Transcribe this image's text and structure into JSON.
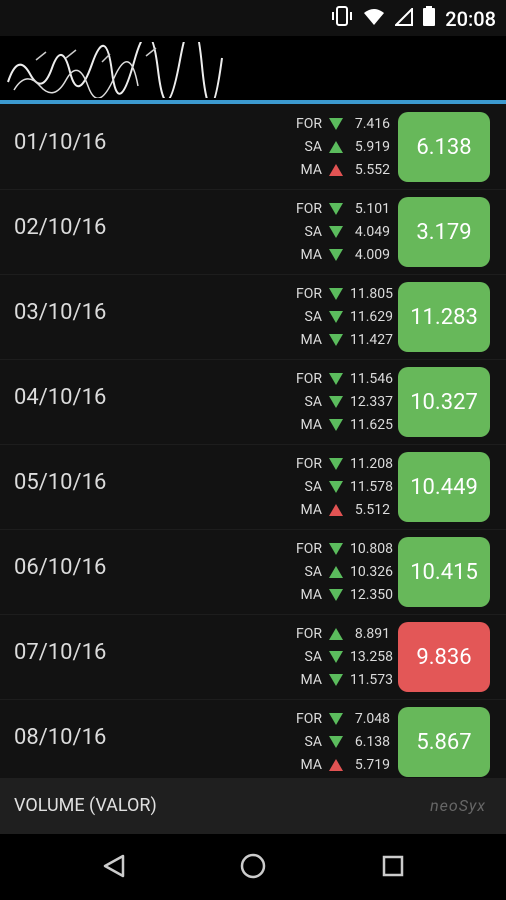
{
  "status_bar": {
    "time": "20:08"
  },
  "footer": {
    "label": "VOLUME (VALOR)",
    "brand": "neoSyx"
  },
  "rows": [
    {
      "date": "01/10/16",
      "value": "6.138",
      "value_color": "green",
      "metrics": [
        {
          "label": "FOR",
          "trend": "down",
          "trend_color": "green",
          "value": "7.416"
        },
        {
          "label": "SA",
          "trend": "up",
          "trend_color": "green",
          "value": "5.919"
        },
        {
          "label": "MA",
          "trend": "up",
          "trend_color": "red",
          "value": "5.552"
        }
      ]
    },
    {
      "date": "02/10/16",
      "value": "3.179",
      "value_color": "green",
      "metrics": [
        {
          "label": "FOR",
          "trend": "down",
          "trend_color": "green",
          "value": "5.101"
        },
        {
          "label": "SA",
          "trend": "down",
          "trend_color": "green",
          "value": "4.049"
        },
        {
          "label": "MA",
          "trend": "down",
          "trend_color": "green",
          "value": "4.009"
        }
      ]
    },
    {
      "date": "03/10/16",
      "value": "11.283",
      "value_color": "green",
      "metrics": [
        {
          "label": "FOR",
          "trend": "down",
          "trend_color": "green",
          "value": "11.805"
        },
        {
          "label": "SA",
          "trend": "down",
          "trend_color": "green",
          "value": "11.629"
        },
        {
          "label": "MA",
          "trend": "down",
          "trend_color": "green",
          "value": "11.427"
        }
      ]
    },
    {
      "date": "04/10/16",
      "value": "10.327",
      "value_color": "green",
      "metrics": [
        {
          "label": "FOR",
          "trend": "down",
          "trend_color": "green",
          "value": "11.546"
        },
        {
          "label": "SA",
          "trend": "down",
          "trend_color": "green",
          "value": "12.337"
        },
        {
          "label": "MA",
          "trend": "down",
          "trend_color": "green",
          "value": "11.625"
        }
      ]
    },
    {
      "date": "05/10/16",
      "value": "10.449",
      "value_color": "green",
      "metrics": [
        {
          "label": "FOR",
          "trend": "down",
          "trend_color": "green",
          "value": "11.208"
        },
        {
          "label": "SA",
          "trend": "down",
          "trend_color": "green",
          "value": "11.578"
        },
        {
          "label": "MA",
          "trend": "up",
          "trend_color": "red",
          "value": "5.512"
        }
      ]
    },
    {
      "date": "06/10/16",
      "value": "10.415",
      "value_color": "green",
      "metrics": [
        {
          "label": "FOR",
          "trend": "down",
          "trend_color": "green",
          "value": "10.808"
        },
        {
          "label": "SA",
          "trend": "up",
          "trend_color": "green",
          "value": "10.326"
        },
        {
          "label": "MA",
          "trend": "down",
          "trend_color": "green",
          "value": "12.350"
        }
      ]
    },
    {
      "date": "07/10/16",
      "value": "9.836",
      "value_color": "red",
      "metrics": [
        {
          "label": "FOR",
          "trend": "up",
          "trend_color": "green",
          "value": "8.891"
        },
        {
          "label": "SA",
          "trend": "down",
          "trend_color": "green",
          "value": "13.258"
        },
        {
          "label": "MA",
          "trend": "down",
          "trend_color": "green",
          "value": "11.573"
        }
      ]
    },
    {
      "date": "08/10/16",
      "value": "5.867",
      "value_color": "green",
      "metrics": [
        {
          "label": "FOR",
          "trend": "down",
          "trend_color": "green",
          "value": "7.048"
        },
        {
          "label": "SA",
          "trend": "down",
          "trend_color": "green",
          "value": "6.138"
        },
        {
          "label": "MA",
          "trend": "up",
          "trend_color": "red",
          "value": "5.719"
        }
      ]
    }
  ]
}
